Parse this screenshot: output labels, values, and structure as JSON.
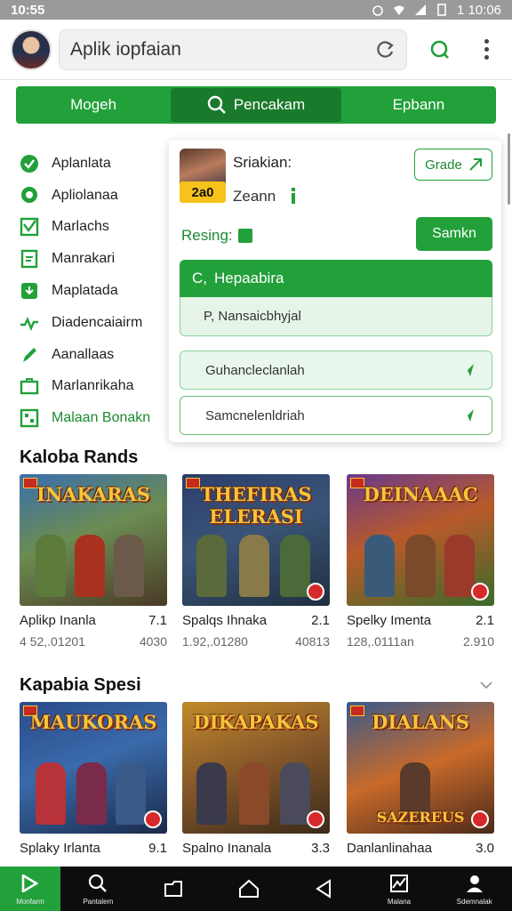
{
  "status_bar": {
    "time": "10:55",
    "right_time": "1 10:06"
  },
  "header": {
    "search_text": "Aplik iopfaian",
    "icons": [
      "refresh-icon",
      "search-icon",
      "more-vert-icon"
    ]
  },
  "tabs": [
    {
      "label": "Mogeh",
      "active": false
    },
    {
      "label": "Pencakam",
      "active": true
    },
    {
      "label": "Epbann",
      "active": false
    }
  ],
  "sidebar": {
    "items": [
      {
        "label": "Aplanlata",
        "icon": "check-circle-icon"
      },
      {
        "label": "Apliolanaa",
        "icon": "chat-bubble-icon"
      },
      {
        "label": "Marlachs",
        "icon": "checkbox-icon"
      },
      {
        "label": "Manrakari",
        "icon": "document-icon"
      },
      {
        "label": "Maplatada",
        "icon": "download-icon"
      },
      {
        "label": "Diadencaiairm",
        "icon": "trend-icon"
      },
      {
        "label": "Aanallaas",
        "icon": "pen-icon"
      },
      {
        "label": "Marlanrikaha",
        "icon": "briefcase-icon"
      },
      {
        "label": "Malaan Bonakn",
        "icon": "grid-icon",
        "highlight": true
      }
    ]
  },
  "popup": {
    "title": "Sriakian:",
    "badge": "2a0",
    "subtitle": "Zeann",
    "grade_label": "Grade",
    "resing_label": "Resing:",
    "action_label": "Samkn",
    "options_header": "Hepaabira",
    "options_prefix": "C,",
    "options": [
      {
        "label": "Nansaicbhyjal",
        "prefix": "P,"
      },
      {
        "label": "Guhancleclanlah"
      },
      {
        "label": "Samcnelenldriah"
      }
    ]
  },
  "sections": [
    {
      "title": "Kaloba Rands",
      "cards": [
        {
          "logo": "INAKARAS",
          "name": "Aplikp Inanla",
          "rating": "7.1",
          "downloads": "4 52,.01201",
          "size": "4030"
        },
        {
          "logo": "THEFIRAS ELERASI",
          "name": "Spalqs Ihnaka",
          "rating": "2.1",
          "downloads": "1.92,.01280",
          "size": "40813"
        },
        {
          "logo": "DEINAAAC",
          "name": "Spelky Imenta",
          "rating": "2.1",
          "downloads": "128,.0111an",
          "size": "2.910"
        }
      ]
    },
    {
      "title": "Kapabia Spesi",
      "cards": [
        {
          "logo": "MAUKORAS",
          "name": "Splaky Irlanta",
          "rating": "9.1",
          "downloads": "",
          "size": ""
        },
        {
          "logo": "DIKAPAKAS",
          "name": "Spalno Inanala",
          "rating": "3.3",
          "downloads": "",
          "size": ""
        },
        {
          "logo": "DIALANS",
          "sublogo": "SAZEREUS",
          "name": "Danlanlinahaa",
          "rating": "3.0",
          "downloads": "",
          "size": ""
        }
      ]
    }
  ],
  "bottom_nav": [
    {
      "label": "Monfarm",
      "icon": "home-flag-icon",
      "active": true
    },
    {
      "label": "Pantalem",
      "icon": "search-icon"
    },
    {
      "label": "",
      "icon": "folder-icon"
    },
    {
      "label": "",
      "icon": "home-icon"
    },
    {
      "label": "",
      "icon": "back-icon"
    },
    {
      "label": "Malana",
      "icon": "chart-icon"
    },
    {
      "label": "Sdemnalak",
      "icon": "person-icon"
    }
  ],
  "colors": {
    "accent": "#22a03a",
    "accent_dark": "#1a7a2c",
    "badge": "#f6c21b"
  }
}
